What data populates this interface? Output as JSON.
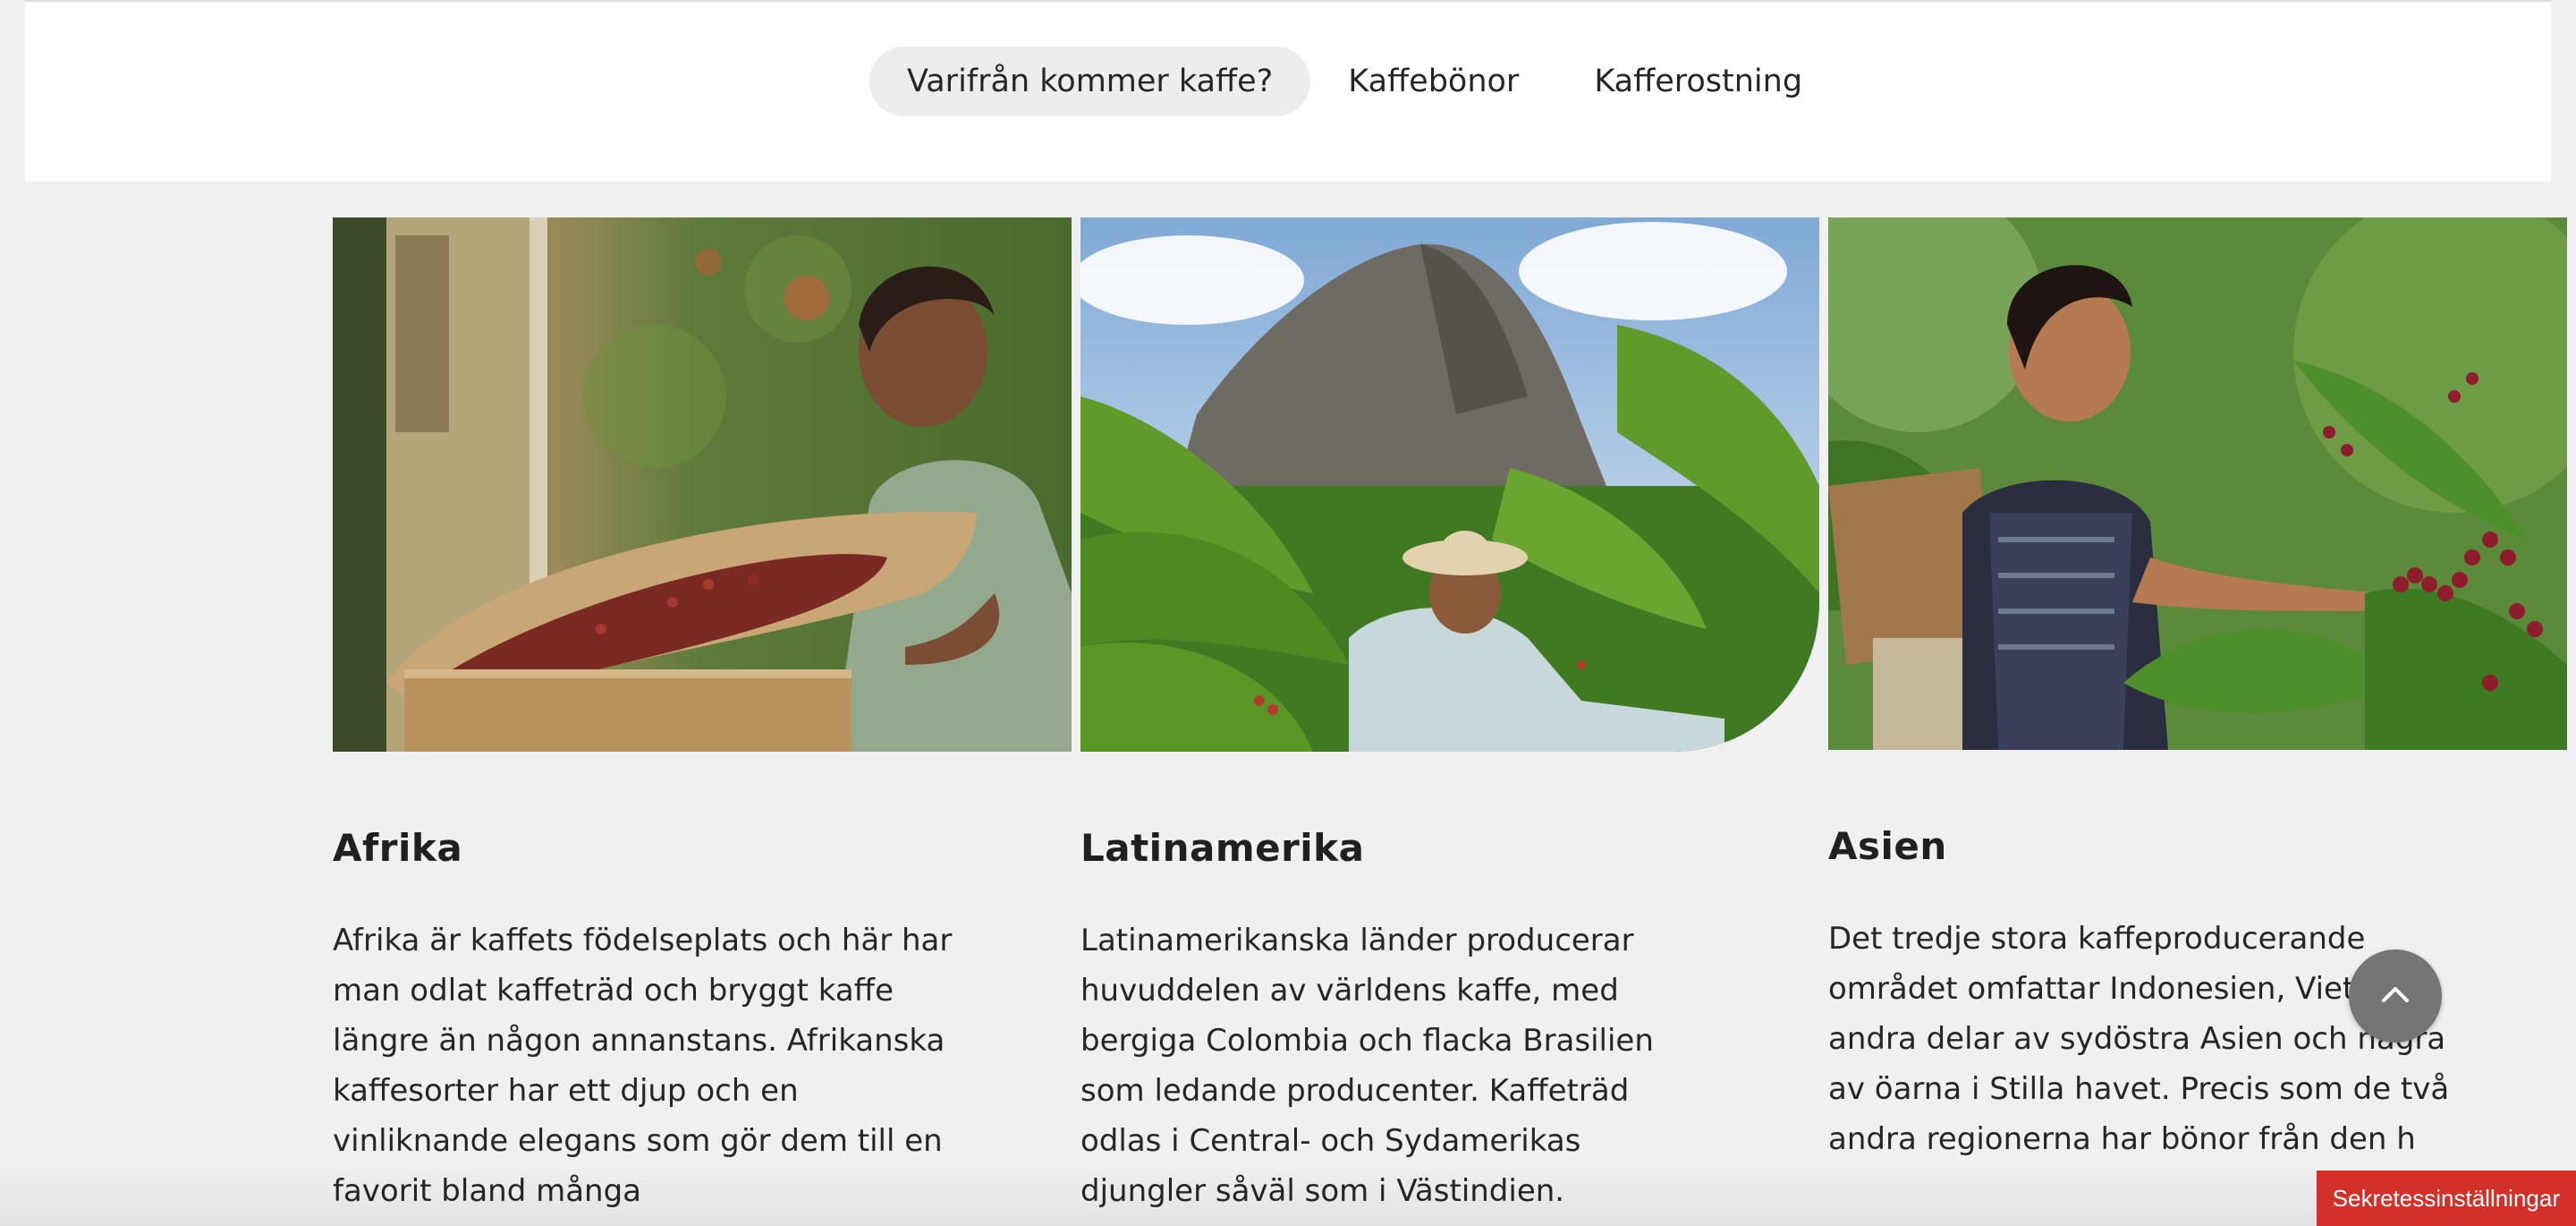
{
  "nav": {
    "items": [
      {
        "label": "Varifrån kommer kaffe?",
        "active": true
      },
      {
        "label": "Kaffebönor",
        "active": false
      },
      {
        "label": "Kafferostning",
        "active": false
      }
    ]
  },
  "regions": [
    {
      "title": "Afrika",
      "text": "Afrika är kaffets födelseplats och här har man odlat kaffeträd och bryggt kaffe längre än någon annanstans. Afrikanska kaffesorter har ett djup och en vinliknande elegans som gör dem till en favorit bland många",
      "image": "woman-sorting-coffee-cherries-photo"
    },
    {
      "title": "Latinamerika",
      "text": "Latinamerikanska länder producerar huvuddelen av världens kaffe, med bergiga Colombia och flacka Brasilien som ledande producenter.  Kaffeträd odlas i Central- och Sydamerikas djungler såväl som i Västindien.",
      "image": "coffee-plantation-mountain-photo"
    },
    {
      "title": "Asien",
      "text": "Det tredje stora kaffeproducerande området omfattar Indonesien, Vietnam, andra delar av sydöstra Asien och några av öarna i Stilla havet.  Precis som de två andra regionerna har bönor från den h",
      "image": "woman-picking-coffee-cherries-photo"
    }
  ],
  "scroll_top": {
    "icon": "chevron-up-icon"
  },
  "privacy": {
    "label": "Sekretessinställningar"
  },
  "colors": {
    "background": "#f0f0f0",
    "active_tab": "#ededed",
    "privacy_button": "#d3302a",
    "scroll_button": "#757575"
  }
}
